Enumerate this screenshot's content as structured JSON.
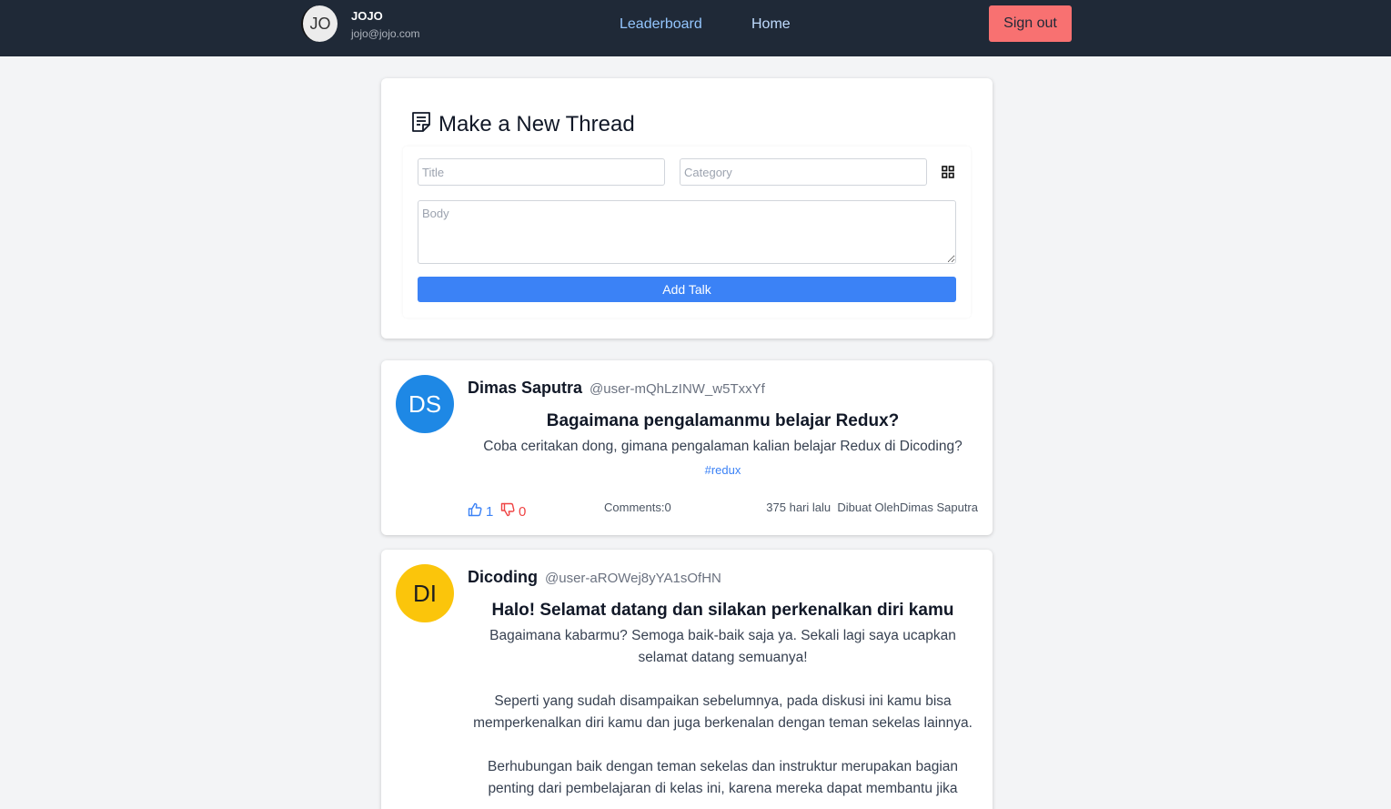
{
  "user": {
    "initials": "JO",
    "name": "JOJO",
    "email": "jojo@jojo.com"
  },
  "nav": {
    "leaderboard": "Leaderboard",
    "home": "Home",
    "sign_out": "Sign out"
  },
  "form": {
    "heading": "Make a New Thread",
    "title_placeholder": "Title",
    "category_placeholder": "Category",
    "body_placeholder": "Body",
    "submit_label": "Add Talk"
  },
  "threads": [
    {
      "initials": "DS",
      "owner_name": "Dimas Saputra",
      "owner_id": "@user-mQhLzINW_w5TxxYf",
      "title": "Bagaimana pengalamanmu belajar Redux?",
      "body": [
        "Coba ceritakan dong, gimana pengalaman kalian belajar Redux di Dicoding?"
      ],
      "category": "#redux",
      "upvotes": "1",
      "downvotes": "0",
      "comments_label": "Comments:0",
      "created": "375 hari lalu",
      "created_by": "Dibuat OlehDimas Saputra",
      "avatar_color": "#1e88e5"
    },
    {
      "initials": "DI",
      "owner_name": "Dicoding",
      "owner_id": "@user-aROWej8yYA1sOfHN",
      "title": "Halo! Selamat datang dan silakan perkenalkan diri kamu",
      "body": [
        "Bagaimana kabarmu? Semoga baik-baik saja ya. Sekali lagi saya ucapkan selamat datang semuanya!",
        "Seperti yang sudah disampaikan sebelumnya, pada diskusi ini kamu bisa memperkenalkan diri kamu dan juga berkenalan dengan teman sekelas lainnya.",
        "Berhubungan baik dengan teman sekelas dan instruktur merupakan bagian penting dari pembelajaran di kelas ini, karena mereka dapat membantu jika"
      ],
      "avatar_color": "#fbc50b"
    }
  ],
  "colors": {
    "navbar": "#1f2937",
    "accent": "#3b82f6",
    "signout": "#f87171",
    "upvote": "#3b82f6",
    "downvote": "#ef4444"
  }
}
